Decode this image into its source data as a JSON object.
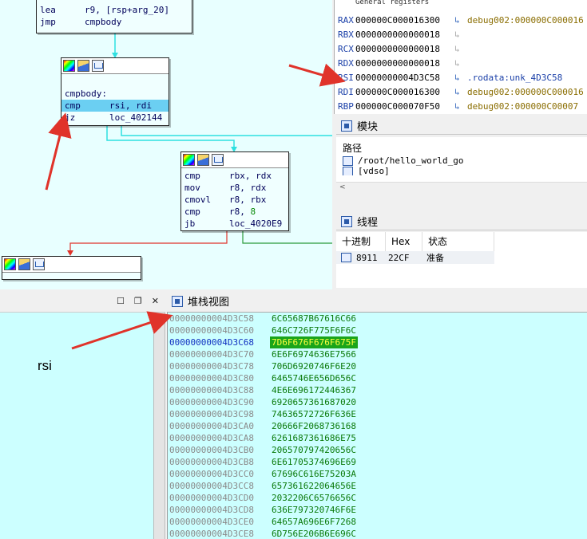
{
  "graph": {
    "top_node": [
      {
        "op": "lea",
        "args": "r9, [rsp+arg_20]"
      },
      {
        "op": "jmp",
        "args": "cmpbody"
      }
    ],
    "cmp_node": {
      "label": "cmpbody:",
      "rows": [
        {
          "op": "cmp",
          "args": "rsi, rdi"
        },
        {
          "op": "jz",
          "args": "loc_402144"
        }
      ]
    },
    "body_node": [
      {
        "op": "cmp",
        "args": "rbx, rdx"
      },
      {
        "op": "mov",
        "args": "r8, rdx"
      },
      {
        "op": "cmovl",
        "args": "r8, rbx"
      },
      {
        "op": "cmp",
        "a1": "r8, ",
        "a2": "8"
      },
      {
        "op": "jb",
        "args": "loc_4020E9"
      }
    ]
  },
  "registers": {
    "title": "General registers",
    "rows": [
      {
        "name": "RAX",
        "value": "000000C000016300",
        "target": "debug002:000000C000016",
        "arrow": "blue",
        "tcolor": "gold"
      },
      {
        "name": "RBX",
        "value": "0000000000000018",
        "target": "",
        "arrow": "grey",
        "tcolor": "gold"
      },
      {
        "name": "RCX",
        "value": "0000000000000018",
        "target": "",
        "arrow": "grey",
        "tcolor": "gold"
      },
      {
        "name": "RDX",
        "value": "0000000000000018",
        "target": "",
        "arrow": "grey",
        "tcolor": "gold"
      },
      {
        "name": "RSI",
        "value": "00000000004D3C58",
        "target": ".rodata:unk_4D3C58",
        "arrow": "blue",
        "tcolor": "blue"
      },
      {
        "name": "RDI",
        "value": "000000C000016300",
        "target": "debug002:000000C000016",
        "arrow": "blue",
        "tcolor": "gold"
      },
      {
        "name": "RBP",
        "value": "000000C000070F50",
        "target": "debug002:000000C00007",
        "arrow": "blue",
        "tcolor": "gold"
      }
    ]
  },
  "modules": {
    "title": "模块",
    "column": "路径",
    "items": [
      "/root/hello_world_go",
      "[vdso]"
    ]
  },
  "threads": {
    "title": "线程",
    "columns": [
      "十进制",
      "Hex",
      "状态"
    ],
    "rows": [
      {
        "dec": "8911",
        "hex": "22CF",
        "state": "准备"
      }
    ]
  },
  "stack": {
    "title": "堆栈视图",
    "rows": [
      {
        "addr": "00000000004D3C58",
        "val": "6C65687B67616C66"
      },
      {
        "addr": "00000000004D3C60",
        "val": "646C726F775F6F6C"
      },
      {
        "addr": "00000000004D3C68",
        "val": "7D6F676F676F675F",
        "hl": true
      },
      {
        "addr": "00000000004D3C70",
        "val": "6E6F6974636E7566"
      },
      {
        "addr": "00000000004D3C78",
        "val": "706D6920746F6E20"
      },
      {
        "addr": "00000000004D3C80",
        "val": "6465746E656D656C"
      },
      {
        "addr": "00000000004D3C88",
        "val": "4E6E696172446367"
      },
      {
        "addr": "00000000004D3C90",
        "val": "6920657361687020"
      },
      {
        "addr": "00000000004D3C98",
        "val": "74636572726F636E"
      },
      {
        "addr": "00000000004D3CA0",
        "val": "20666F2068736168"
      },
      {
        "addr": "00000000004D3CA8",
        "val": "6261687361686E75"
      },
      {
        "addr": "00000000004D3CB0",
        "val": "206570797420656C"
      },
      {
        "addr": "00000000004D3CB8",
        "val": "6E61705374696E69"
      },
      {
        "addr": "00000000004D3CC0",
        "val": "67696C616E75203A"
      },
      {
        "addr": "00000000004D3CC8",
        "val": "657361622064656E"
      },
      {
        "addr": "00000000004D3CD0",
        "val": "2032206C6576656C"
      },
      {
        "addr": "00000000004D3CD8",
        "val": "636E797320746F6E"
      },
      {
        "addr": "00000000004D3CE0",
        "val": "64657A696E6F7268"
      },
      {
        "addr": "00000000004D3CE8",
        "val": "6D756E206B6E696C"
      }
    ]
  },
  "annotation": {
    "note": "rsi"
  },
  "colors": {
    "graph_bg": "#e8ffff",
    "hex_bg": "#ccffff",
    "selection": "#6bcff2",
    "arrow_red": "#e0332a"
  }
}
